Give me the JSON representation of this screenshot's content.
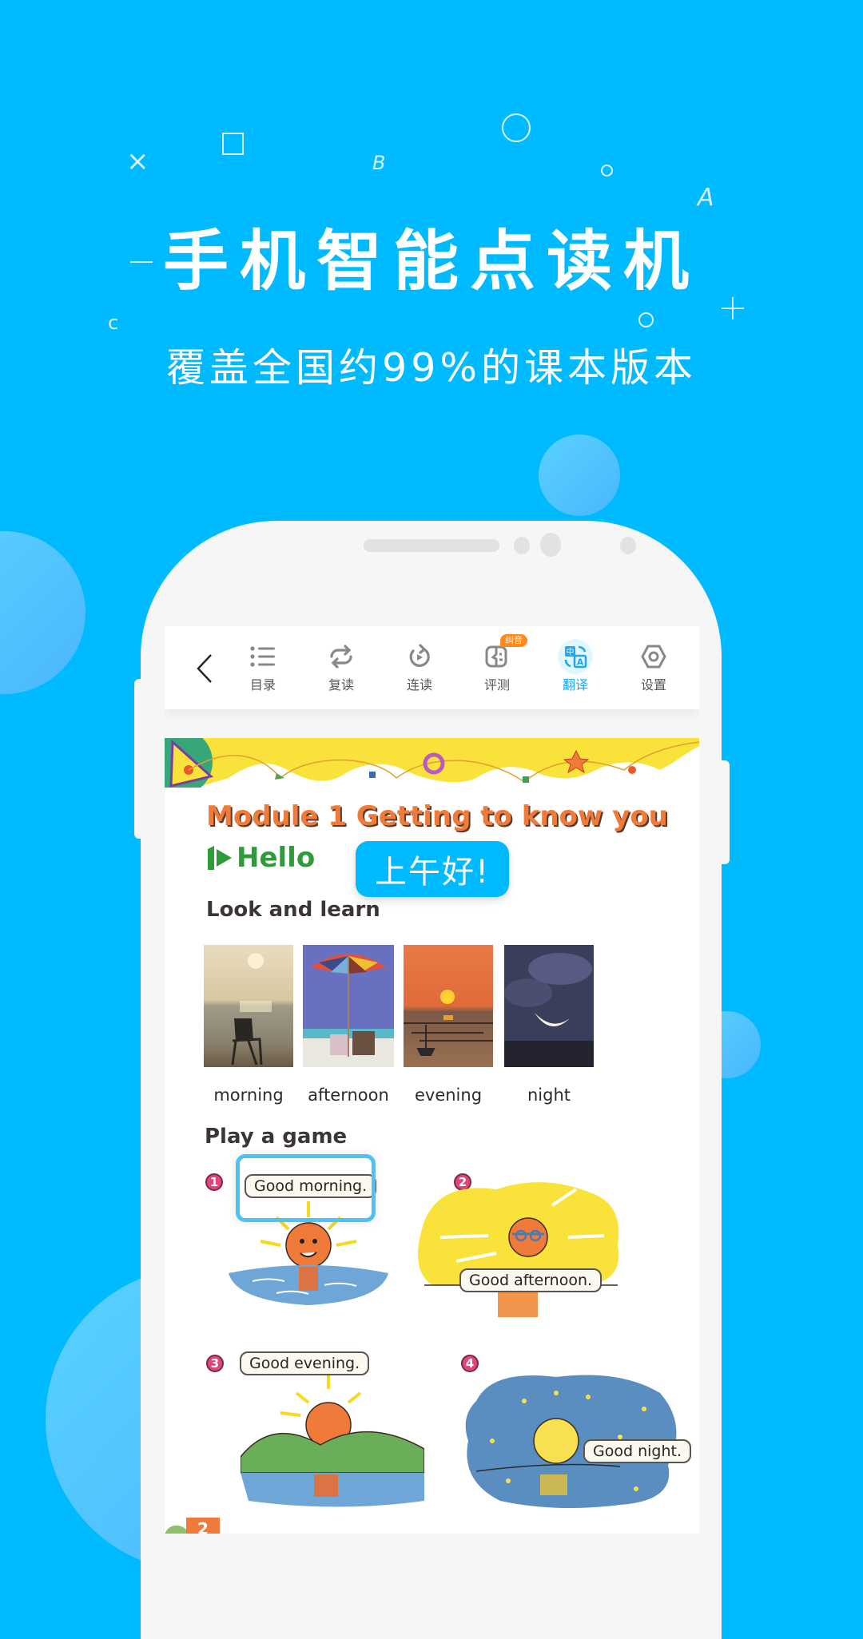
{
  "promo": {
    "headline": "手机智能点读机",
    "subheadline": "覆盖全国约99%的课本版本",
    "decorations": {
      "letter_x": "×",
      "letter_b": "B",
      "letter_a": "A",
      "letter_c": "c",
      "dash": "−",
      "plus": "+"
    }
  },
  "toolbar": {
    "back_icon": "chevron-left-icon",
    "items": [
      {
        "label": "目录",
        "icon": "list-icon",
        "active": false
      },
      {
        "label": "复读",
        "icon": "repeat-icon",
        "active": false
      },
      {
        "label": "连读",
        "icon": "continuous-play-icon",
        "active": false
      },
      {
        "label": "评测",
        "icon": "evaluate-face-icon",
        "active": false,
        "badge": "纠音"
      },
      {
        "label": "翻译",
        "icon": "translate-icon",
        "active": true
      },
      {
        "label": "设置",
        "icon": "settings-hex-icon",
        "active": false
      }
    ],
    "active_color": "#1fa7f0",
    "badge_color": "#ff8a1c"
  },
  "textbook": {
    "module_title": "Module 1  Getting to know you",
    "unit_marker": "1",
    "unit_title": "Hello",
    "translation_popup": "上午好!",
    "look_and_learn": {
      "heading": "Look and learn",
      "pictures": [
        {
          "label": "morning"
        },
        {
          "label": "afternoon"
        },
        {
          "label": "evening"
        },
        {
          "label": "night"
        }
      ]
    },
    "play_a_game": {
      "heading": "Play a game",
      "scenes": [
        {
          "number": "1",
          "speech": "Good morning.",
          "selected": true
        },
        {
          "number": "2",
          "speech": "Good afternoon.",
          "selected": false
        },
        {
          "number": "3",
          "speech": "Good evening.",
          "selected": false
        },
        {
          "number": "4",
          "speech": "Good night.",
          "selected": false
        }
      ]
    },
    "next_unit_number": "2"
  },
  "colors": {
    "background": "#00baff",
    "translation_popup": "#00baff",
    "selection_border": "#4cc3f5"
  }
}
